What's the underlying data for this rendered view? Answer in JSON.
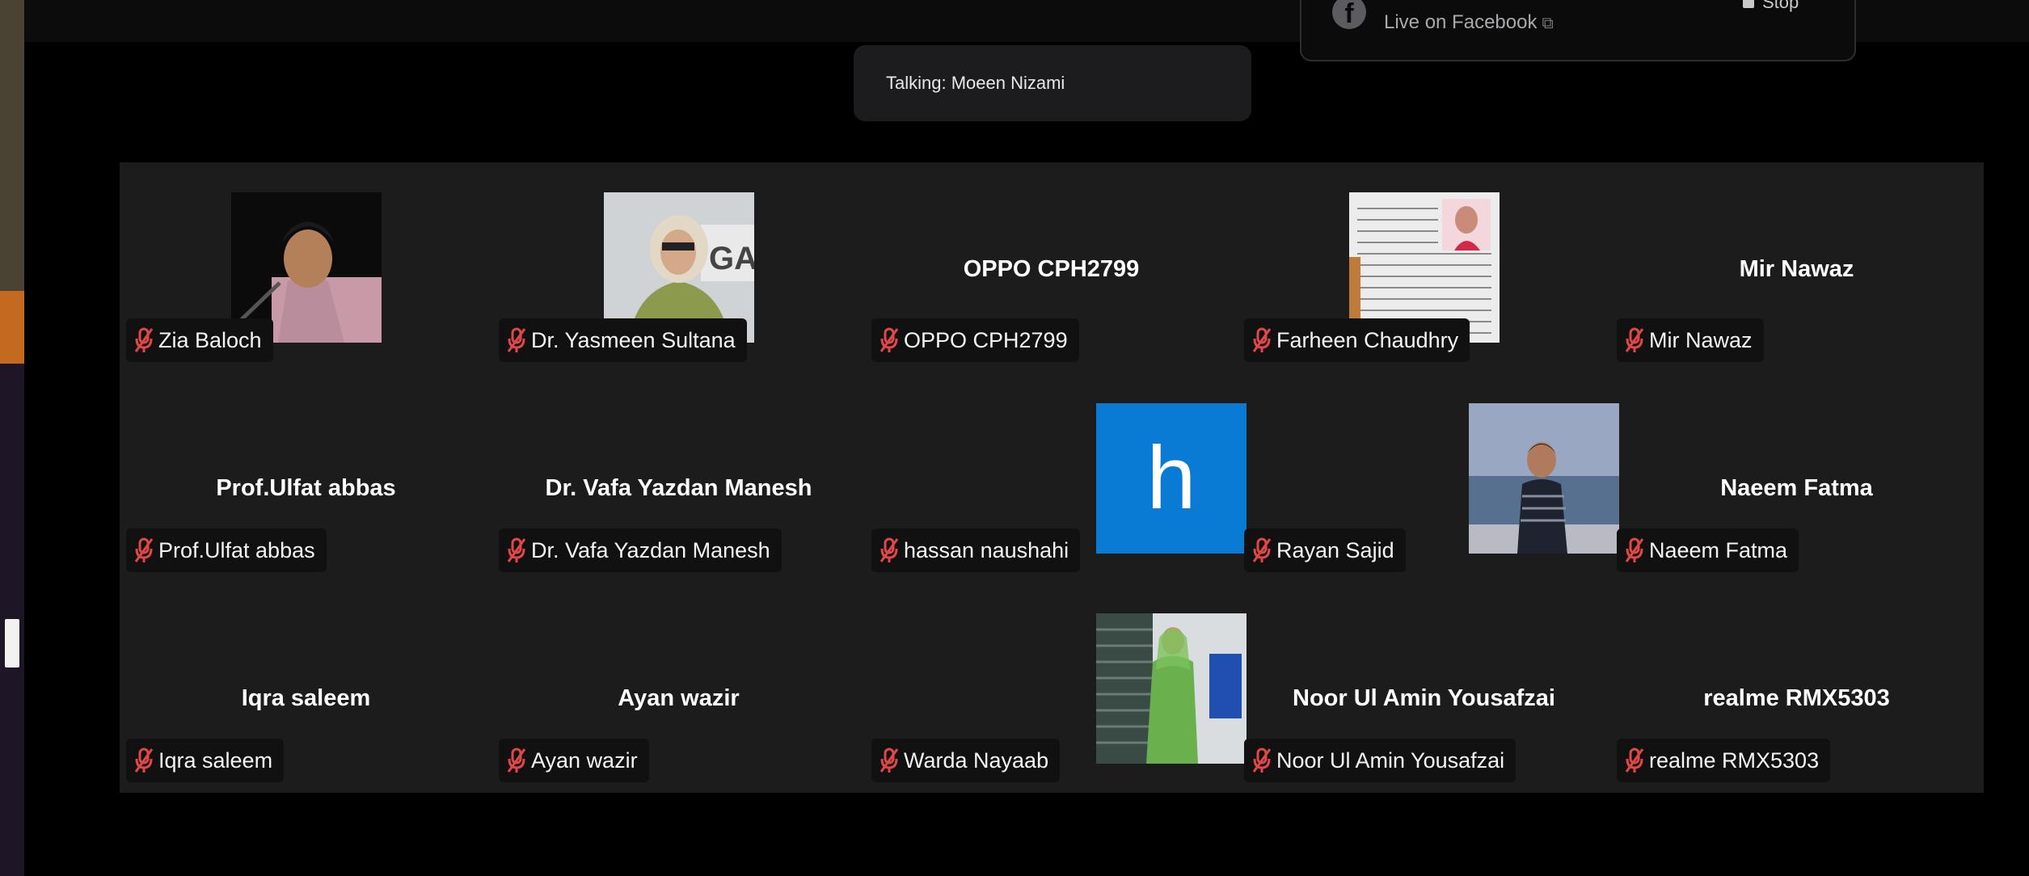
{
  "live": {
    "text": "Live on Facebook",
    "stop_label": "Stop",
    "fb_glyph": "f",
    "ext_glyph": "⧉"
  },
  "talking": {
    "text": "Talking: Moeen Nizami"
  },
  "participants": [
    {
      "name": "Zia Baloch",
      "display": "",
      "video": "photo"
    },
    {
      "name": "Dr. Yasmeen Sultana",
      "display": "",
      "video": "photo"
    },
    {
      "name": "OPPO CPH2799",
      "display": "OPPO CPH2799",
      "video": "none"
    },
    {
      "name": "Farheen Chaudhry",
      "display": "",
      "video": "photo"
    },
    {
      "name": "Mir Nawaz",
      "display": "Mir Nawaz",
      "video": "none"
    },
    {
      "name": "Prof.Ulfat abbas",
      "display": "Prof.Ulfat abbas",
      "video": "none"
    },
    {
      "name": "Dr. Vafa Yazdan Manesh",
      "display": "Dr. Vafa Yazdan Manesh",
      "video": "none"
    },
    {
      "name": "hassan naushahi",
      "display": "",
      "video": "avatar",
      "avatar_letter": "h"
    },
    {
      "name": "Rayan Sajid",
      "display": "",
      "video": "photo"
    },
    {
      "name": "Naeem Fatma",
      "display": "Naeem Fatma",
      "video": "none"
    },
    {
      "name": "Iqra saleem",
      "display": "Iqra saleem",
      "video": "none"
    },
    {
      "name": "Ayan wazir",
      "display": "Ayan wazir",
      "video": "none"
    },
    {
      "name": "Warda Nayaab",
      "display": "",
      "video": "photo"
    },
    {
      "name": "Noor Ul Amin Yousafzai",
      "display": "Noor Ul Amin Yousafzai",
      "video": "none"
    },
    {
      "name": "realme RMX5303",
      "display": "realme RMX5303",
      "video": "none"
    }
  ],
  "colors": {
    "muted_mic": "#e04848",
    "avatar_bg": "#0a7bd4",
    "tile_bg": "#1c1c1c"
  }
}
